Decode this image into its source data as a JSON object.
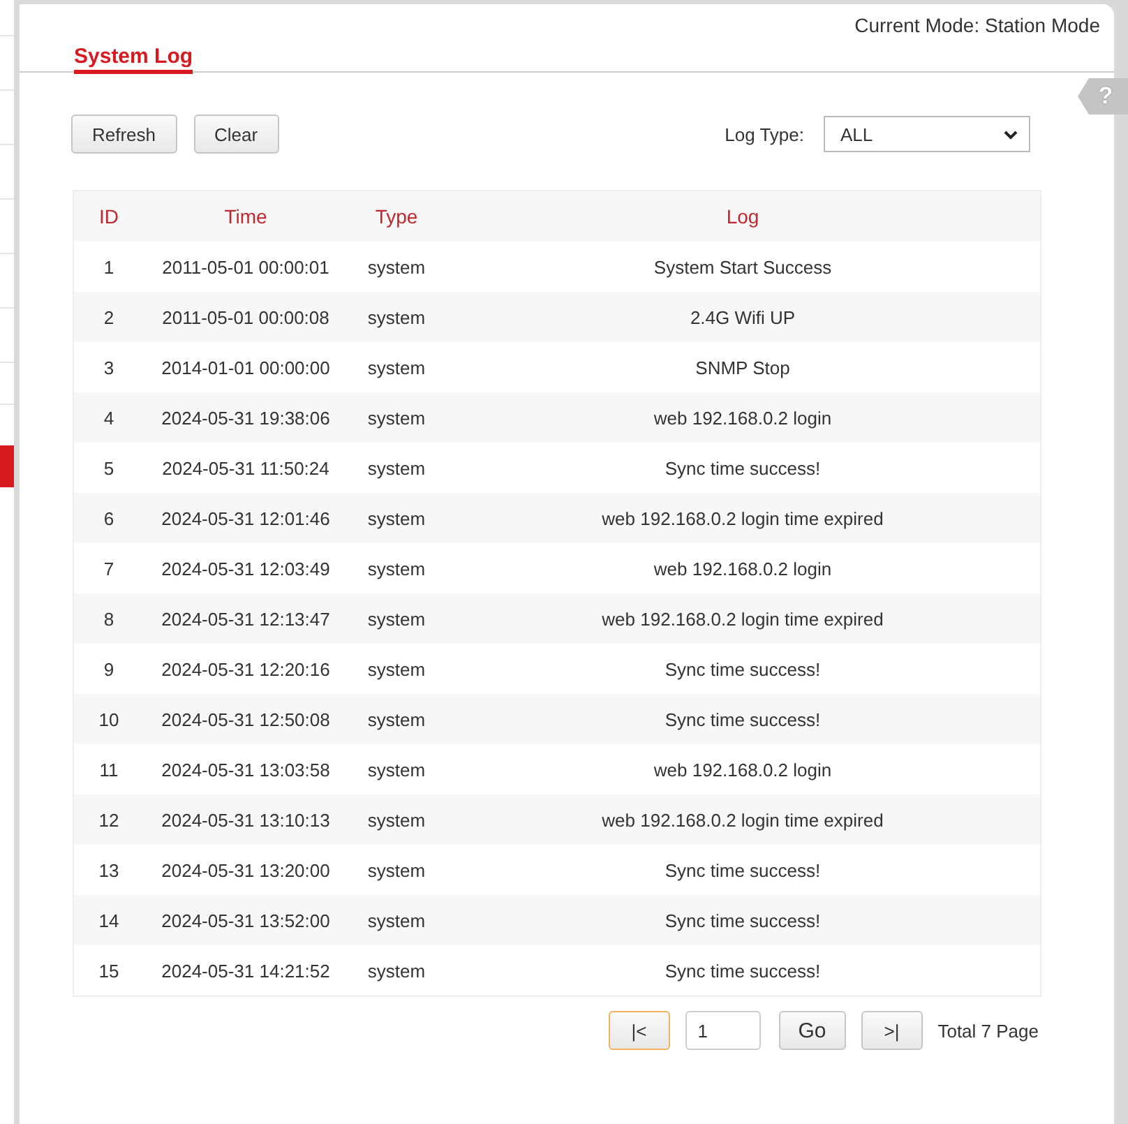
{
  "sidebar": {
    "items": [
      {
        "selected": false
      },
      {
        "selected": false
      },
      {
        "selected": false
      },
      {
        "selected": false
      },
      {
        "selected": false
      },
      {
        "selected": false
      },
      {
        "selected": false
      },
      {
        "selected": false
      },
      {
        "selected": true
      }
    ]
  },
  "header": {
    "mode": "Current Mode: Station Mode",
    "title": "System Log",
    "help": "?"
  },
  "toolbar": {
    "buttons": [
      "Refresh",
      "Clear"
    ],
    "log_type_label": "Log Type:",
    "log_type_value": "ALL"
  },
  "table": {
    "columns": [
      "ID",
      "Time",
      "Type",
      "Log"
    ],
    "rows": [
      [
        "1",
        "2011-05-01 00:00:01",
        "system",
        "System Start Success"
      ],
      [
        "2",
        "2011-05-01 00:00:08",
        "system",
        "2.4G Wifi UP"
      ],
      [
        "3",
        "2014-01-01 00:00:00",
        "system",
        "SNMP Stop"
      ],
      [
        "4",
        "2024-05-31 19:38:06",
        "system",
        "web 192.168.0.2 login"
      ],
      [
        "5",
        "2024-05-31 11:50:24",
        "system",
        "Sync time success!"
      ],
      [
        "6",
        "2024-05-31 12:01:46",
        "system",
        "web 192.168.0.2 login time expired"
      ],
      [
        "7",
        "2024-05-31 12:03:49",
        "system",
        "web 192.168.0.2 login"
      ],
      [
        "8",
        "2024-05-31 12:13:47",
        "system",
        "web 192.168.0.2 login time expired"
      ],
      [
        "9",
        "2024-05-31 12:20:16",
        "system",
        "Sync time success!"
      ],
      [
        "10",
        "2024-05-31 12:50:08",
        "system",
        "Sync time success!"
      ],
      [
        "11",
        "2024-05-31 13:03:58",
        "system",
        "web 192.168.0.2 login"
      ],
      [
        "12",
        "2024-05-31 13:10:13",
        "system",
        "web 192.168.0.2 login time expired"
      ],
      [
        "13",
        "2024-05-31 13:20:00",
        "system",
        "Sync time success!"
      ],
      [
        "14",
        "2024-05-31 13:52:00",
        "system",
        "Sync time success!"
      ],
      [
        "15",
        "2024-05-31 14:21:52",
        "system",
        "Sync time success!"
      ]
    ]
  },
  "pagination": {
    "first": {
      "label": "|<",
      "focused": true
    },
    "page": "1",
    "go": "Go",
    "last": {
      "label": ">|",
      "focused": false
    },
    "total": "Total 7 Page"
  }
}
